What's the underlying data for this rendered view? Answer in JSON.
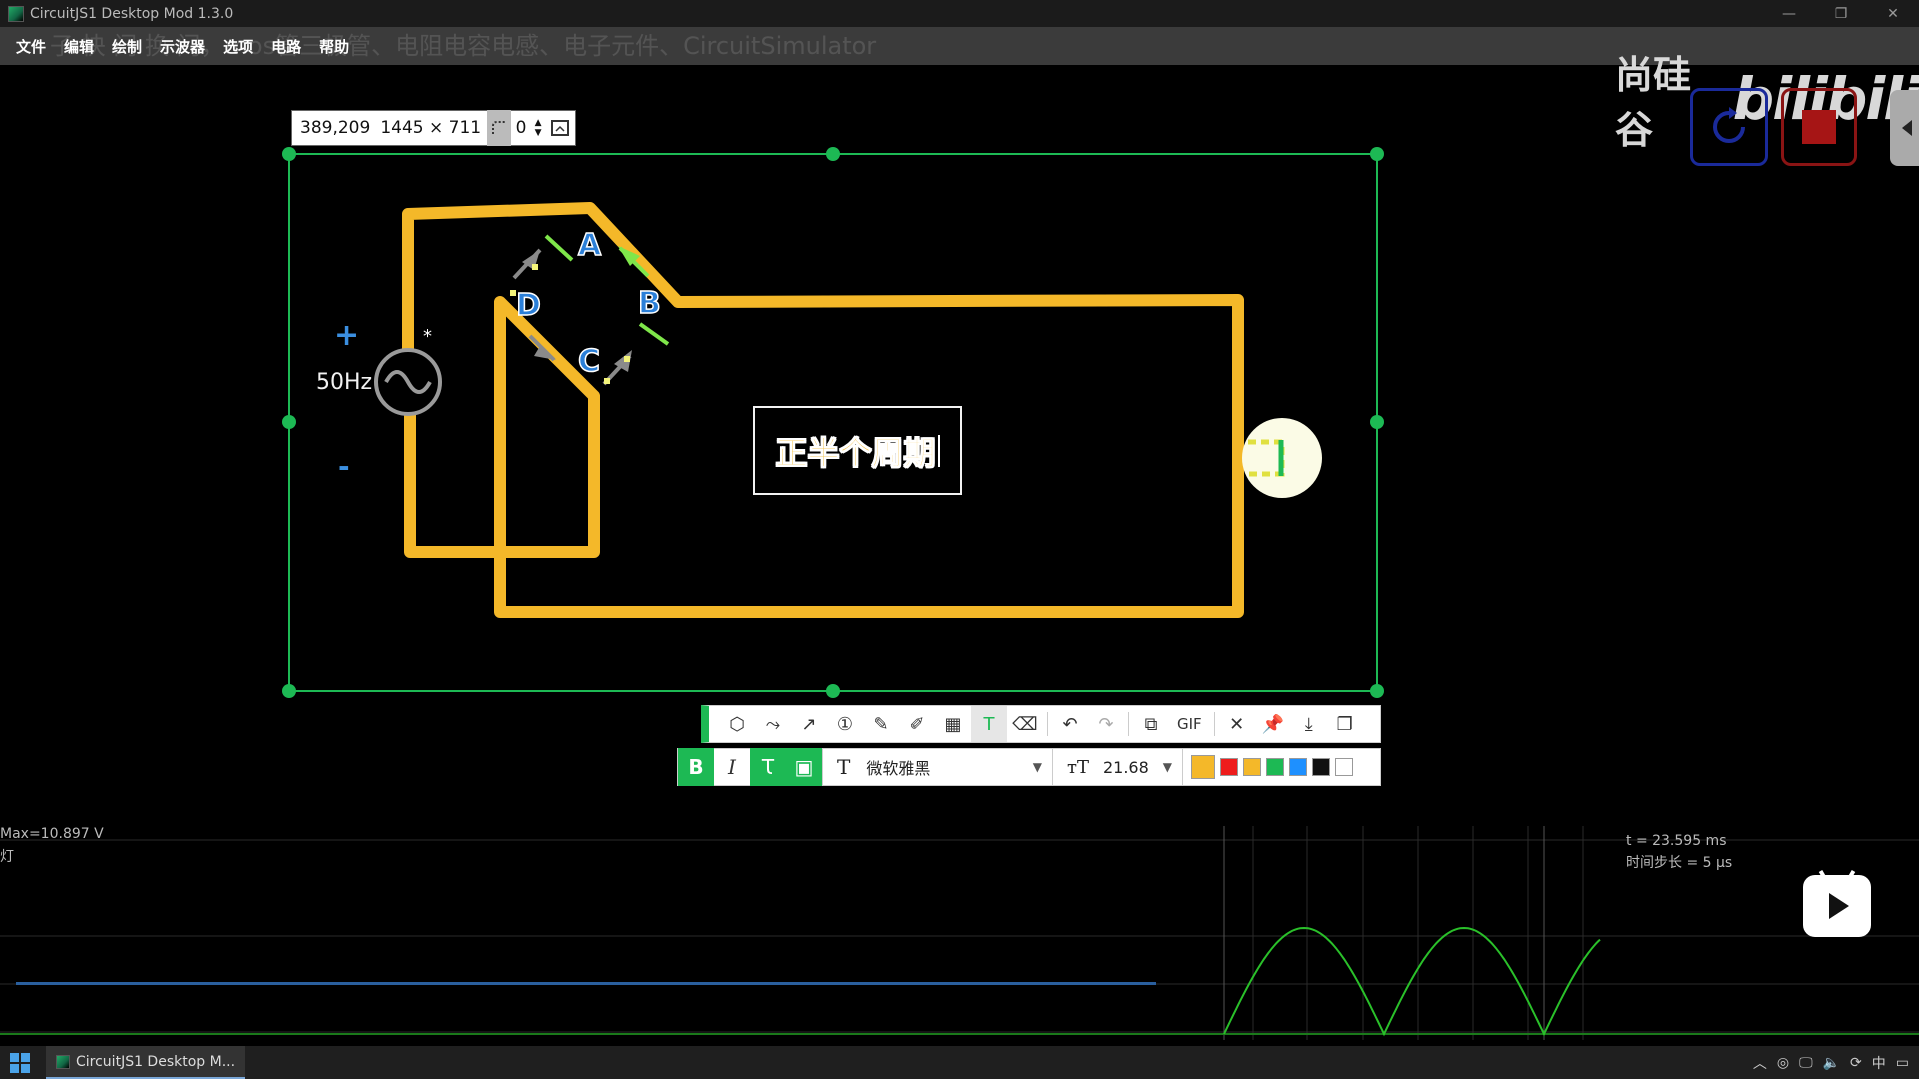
{
  "window": {
    "title": "CircuitJS1 Desktop Mod 1.3.0",
    "controls": [
      "—",
      "❐",
      "✕"
    ]
  },
  "menu": {
    "items": [
      "文件",
      "编辑",
      "绘制",
      "示波器",
      "选项",
      "电路",
      "帮助"
    ],
    "overlay_text": "子     快     门     换     门，mos管三极管、电阻电容电感、电子元件、CircuitSimulator"
  },
  "watermark": {
    "brand": "尚硅谷",
    "logo": "bilibili"
  },
  "selection": {
    "position": "389,209",
    "size": "1445 × 711",
    "radius": "0"
  },
  "circuit": {
    "source_freq": "50Hz",
    "plus": "+",
    "minus": "-",
    "star": "*",
    "diodes": [
      "A",
      "B",
      "C",
      "D"
    ],
    "wire_color": "#f4b829"
  },
  "note": {
    "text": "正半个周期",
    "color": "#f4b829"
  },
  "toolbar": {
    "gif_label": "GIF",
    "font_name": "微软雅黑",
    "font_size": "21.68",
    "colors": [
      "#f4b829",
      "#ee1c1c",
      "#f4b829",
      "#1db954",
      "#1e90ff",
      "#111111",
      "#ffffff"
    ]
  },
  "scope": {
    "max_label": "Max=10.897 V",
    "name_label": "灯",
    "time_label": "t = 23.595 ms",
    "step_label": "时间步长 = 5 μs",
    "playback_progress": 0.74
  },
  "taskbar": {
    "app_label": "CircuitJS1 Desktop M..."
  }
}
